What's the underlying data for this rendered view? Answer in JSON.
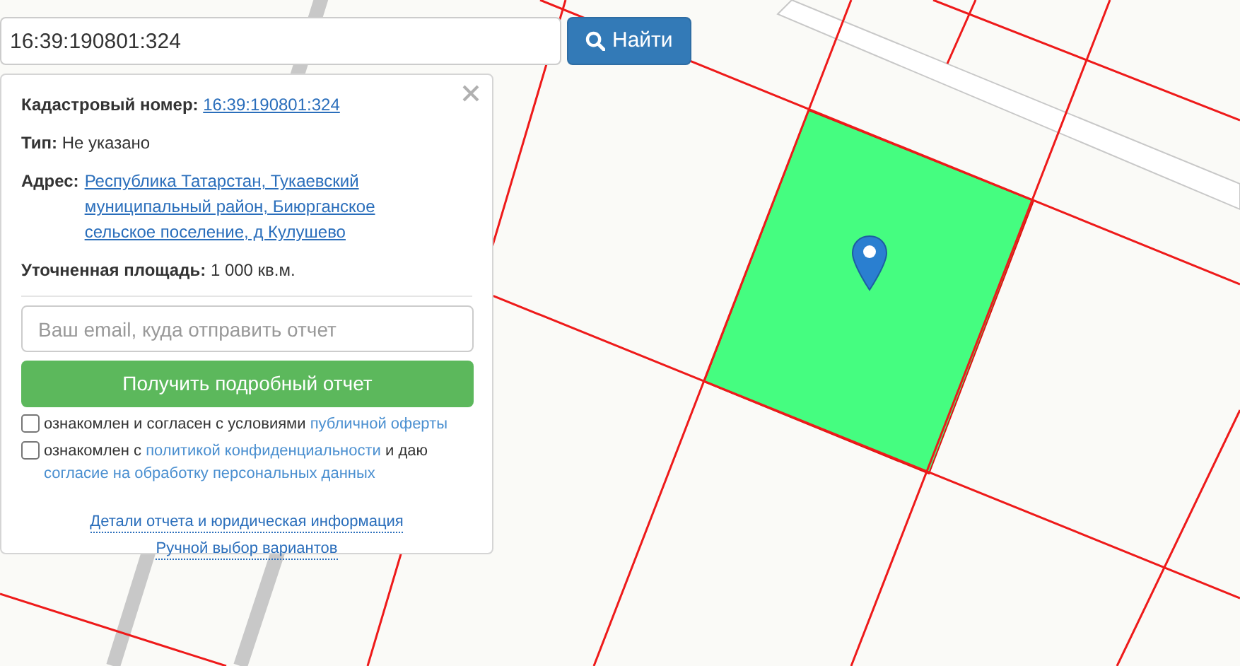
{
  "search": {
    "value": "16:39:190801:324",
    "button": "Найти"
  },
  "info_card": {
    "fields": [
      {
        "label": "Кадастровый номер:",
        "value": "16:39:190801:324",
        "kind": "link"
      },
      {
        "label": "Тип:",
        "value": "Не указано",
        "kind": "text"
      },
      {
        "label": "Адрес:",
        "value": "Республика Татарстан, Тукаевский муниципальный район, Биюрганское сельское поселение, д Кулушево",
        "kind": "link"
      },
      {
        "label": "Уточненная площадь:",
        "value": "1 000 кв.м.",
        "kind": "text"
      }
    ],
    "email": {
      "placeholder": "Ваш email, куда отправить отчет"
    },
    "submit": "Получить подробный отчет",
    "agreements": [
      {
        "checked": false,
        "parts": [
          {
            "kind": "text",
            "text": "ознакомлен и согласен с условиями"
          },
          {
            "kind": "link",
            "text": "публичной оферты"
          }
        ]
      },
      {
        "checked": false,
        "parts": [
          {
            "kind": "text",
            "text": "ознакомлен с"
          },
          {
            "kind": "link",
            "text": "политикой конфиденциальности"
          },
          {
            "kind": "text",
            "text": "и даю"
          },
          {
            "kind": "link",
            "text": "согласие на обработку персональных данных"
          }
        ]
      }
    ],
    "footer_links": [
      "Детали отчета и юридическая информация",
      "Ручной выбор вариантов"
    ]
  }
}
